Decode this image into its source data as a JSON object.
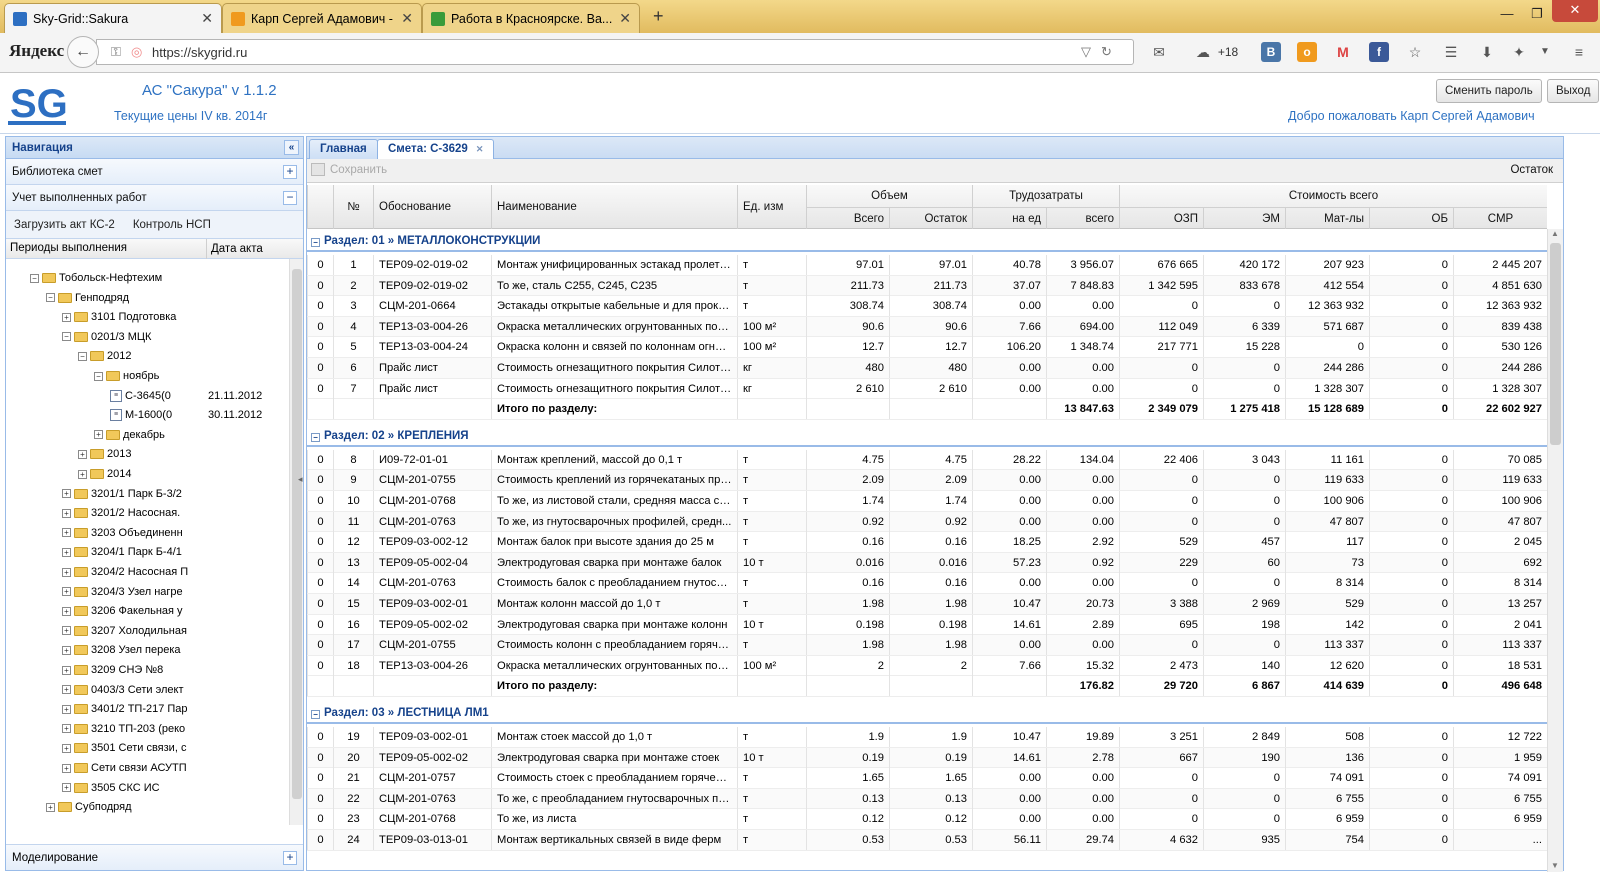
{
  "browser": {
    "tabs": [
      {
        "title": "Sky-Grid::Sakura",
        "color": "#2d6fc2"
      },
      {
        "title": "Карп Сергей Адамович - ...",
        "color": "#f09a1e"
      },
      {
        "title": "Работа в Красноярске. Ва...",
        "color": "#3a9b3a"
      }
    ],
    "new_tab": "+",
    "brand": "Яндекс",
    "url": "https://skygrid.ru",
    "weather": "+18",
    "win_min": "—",
    "win_max": "❐",
    "win_close": "✕"
  },
  "app": {
    "title": "АС \"Сакура\" v 1.1.2",
    "subtitle": "Текущие цены IV кв. 2014г",
    "change_password": "Сменить пароль",
    "logout": "Выход",
    "welcome": "Добро пожаловать Карп Сергей Адамович"
  },
  "nav": {
    "title": "Навигация",
    "library": "Библиотека смет",
    "works": "Учет выполненных работ",
    "load_act": "Загрузить акт КС-2",
    "control": "Контроль НСП",
    "col_periods": "Периоды выполнения",
    "col_date": "Дата акта",
    "modeling": "Моделирование",
    "tree": [
      {
        "label": "Тобольск-Нефтехим",
        "level": 2,
        "type": "folder",
        "expanded": true
      },
      {
        "label": "Генподряд",
        "level": 3,
        "type": "folder",
        "expanded": true
      },
      {
        "label": "3101 Подготовка",
        "level": 4,
        "type": "folder",
        "expanded": false
      },
      {
        "label": "0201/3 МЦК",
        "level": 4,
        "type": "folder",
        "expanded": true
      },
      {
        "label": "2012",
        "level": 5,
        "type": "folder",
        "expanded": true
      },
      {
        "label": "ноябрь",
        "level": 6,
        "type": "folder",
        "expanded": true
      },
      {
        "label": "С-3645(0",
        "level": 7,
        "type": "doc",
        "date": "21.11.2012"
      },
      {
        "label": "М-1600(0",
        "level": 7,
        "type": "doc",
        "date": "30.11.2012"
      },
      {
        "label": "декабрь",
        "level": 6,
        "type": "folder",
        "expanded": false
      },
      {
        "label": "2013",
        "level": 5,
        "type": "folder",
        "expanded": false
      },
      {
        "label": "2014",
        "level": 5,
        "type": "folder",
        "expanded": false
      },
      {
        "label": "3201/1 Парк Б-3/2",
        "level": 4,
        "type": "folder",
        "expanded": false
      },
      {
        "label": "3201/2 Насосная.",
        "level": 4,
        "type": "folder",
        "expanded": false
      },
      {
        "label": "3203 Объединенн",
        "level": 4,
        "type": "folder",
        "expanded": false
      },
      {
        "label": "3204/1 Парк Б-4/1",
        "level": 4,
        "type": "folder",
        "expanded": false
      },
      {
        "label": "3204/2 Насосная П",
        "level": 4,
        "type": "folder",
        "expanded": false
      },
      {
        "label": "3204/3 Узел нагре",
        "level": 4,
        "type": "folder",
        "expanded": false
      },
      {
        "label": "3206 Факельная у",
        "level": 4,
        "type": "folder",
        "expanded": false
      },
      {
        "label": "3207 Холодильная",
        "level": 4,
        "type": "folder",
        "expanded": false
      },
      {
        "label": "3208 Узел перека",
        "level": 4,
        "type": "folder",
        "expanded": false
      },
      {
        "label": "3209 СНЭ №8",
        "level": 4,
        "type": "folder",
        "expanded": false
      },
      {
        "label": "0403/3 Сети элект",
        "level": 4,
        "type": "folder",
        "expanded": false
      },
      {
        "label": "3401/2 ТП-217 Пар",
        "level": 4,
        "type": "folder",
        "expanded": false
      },
      {
        "label": "3210 ТП-203 (реко",
        "level": 4,
        "type": "folder",
        "expanded": false
      },
      {
        "label": "3501 Сети связи, с",
        "level": 4,
        "type": "folder",
        "expanded": false
      },
      {
        "label": "Сети связи АСУТП",
        "level": 4,
        "type": "folder",
        "expanded": false
      },
      {
        "label": "3505 СКС ИС",
        "level": 4,
        "type": "folder",
        "expanded": false
      },
      {
        "label": "Субподряд",
        "level": 3,
        "type": "folder",
        "expanded": false
      }
    ]
  },
  "main": {
    "tabs": [
      "Главная",
      "Смета: С-3629"
    ],
    "save": "Сохранить",
    "remainder": "Остаток",
    "headers": {
      "check": "",
      "num": "№",
      "basis": "Обоснование",
      "name": "Наименование",
      "unit": "Ед. изм",
      "volume": "Объем",
      "vol_total": "Всего",
      "vol_rest": "Остаток",
      "labor": "Трудозатраты",
      "labor_unit": "на ед",
      "labor_total": "всего",
      "cost": "Стоимость всего",
      "ozp": "ОЗП",
      "em": "ЭМ",
      "mat": "Мат-лы",
      "ob": "ОБ",
      "smr": "СМР"
    },
    "sections": [
      {
        "title": "Раздел: 01 » МЕТАЛЛОКОНСТРУКЦИИ",
        "rows": [
          [
            "0",
            "1",
            "ТЕР09-02-019-02",
            "Монтаж унифицированных эстакад пролето...",
            "т",
            "97.01",
            "97.01",
            "40.78",
            "3 956.07",
            "676 665",
            "420 172",
            "207 923",
            "0",
            "2 445 207"
          ],
          [
            "0",
            "2",
            "ТЕР09-02-019-02",
            "То же, сталь С255, С245, С235",
            "т",
            "211.73",
            "211.73",
            "37.07",
            "7 848.83",
            "1 342 595",
            "833 678",
            "412 554",
            "0",
            "4 851 630"
          ],
          [
            "0",
            "3",
            "СЦМ-201-0664",
            "Эстакады открытые кабельные и для прокл...",
            "т",
            "308.74",
            "308.74",
            "0.00",
            "0.00",
            "0",
            "0",
            "12 363 932",
            "0",
            "12 363 932"
          ],
          [
            "0",
            "4",
            "ТЕР13-03-004-26",
            "Окраска металлических огрунтованных пов...",
            "100 м²",
            "90.6",
            "90.6",
            "7.66",
            "694.00",
            "112 049",
            "6 339",
            "571 687",
            "0",
            "839 438"
          ],
          [
            "0",
            "5",
            "ТЕР13-03-004-24",
            "Окраска колонн и связей по колоннам огнез...",
            "100 м²",
            "12.7",
            "12.7",
            "106.20",
            "1 348.74",
            "217 771",
            "15 228",
            "0",
            "0",
            "530 126"
          ],
          [
            "0",
            "6",
            "Прайс лист",
            "Стоимость огнезащитного покрытия Силоте...",
            "кг",
            "480",
            "480",
            "0.00",
            "0.00",
            "0",
            "0",
            "244 286",
            "0",
            "244 286"
          ],
          [
            "0",
            "7",
            "Прайс лист",
            "Стоимость огнезащитного покрытия Силоте...",
            "кг",
            "2 610",
            "2 610",
            "0.00",
            "0.00",
            "0",
            "0",
            "1 328 307",
            "0",
            "1 328 307"
          ]
        ],
        "total": {
          "label": "Итого по разделу:",
          "labor": "13 847.63",
          "ozp": "2 349 079",
          "em": "1 275 418",
          "mat": "15 128 689",
          "ob": "0",
          "smr": "22 602 927"
        }
      },
      {
        "title": "Раздел: 02 » КРЕПЛЕНИЯ",
        "rows": [
          [
            "0",
            "8",
            "И09-72-01-01",
            "Монтаж креплений, массой до 0,1 т",
            "т",
            "4.75",
            "4.75",
            "28.22",
            "134.04",
            "22 406",
            "3 043",
            "11 161",
            "0",
            "70 085"
          ],
          [
            "0",
            "9",
            "СЦМ-201-0755",
            "Стоимость креплений из горячекатаных про...",
            "т",
            "2.09",
            "2.09",
            "0.00",
            "0.00",
            "0",
            "0",
            "119 633",
            "0",
            "119 633"
          ],
          [
            "0",
            "10",
            "СЦМ-201-0768",
            "То же, из листовой стали, средняя масса сбо...",
            "т",
            "1.74",
            "1.74",
            "0.00",
            "0.00",
            "0",
            "0",
            "100 906",
            "0",
            "100 906"
          ],
          [
            "0",
            "11",
            "СЦМ-201-0763",
            "То же, из гнутосварочных профилей, средн...",
            "т",
            "0.92",
            "0.92",
            "0.00",
            "0.00",
            "0",
            "0",
            "47 807",
            "0",
            "47 807"
          ],
          [
            "0",
            "12",
            "ТЕР09-03-002-12",
            "Монтаж балок при высоте здания до 25 м",
            "т",
            "0.16",
            "0.16",
            "18.25",
            "2.92",
            "529",
            "457",
            "117",
            "0",
            "2 045"
          ],
          [
            "0",
            "13",
            "ТЕР09-05-002-04",
            "Электродуговая сварка при монтаже балок",
            "10 т",
            "0.016",
            "0.016",
            "57.23",
            "0.92",
            "229",
            "60",
            "73",
            "0",
            "692"
          ],
          [
            "0",
            "14",
            "СЦМ-201-0763",
            "Стоимость балок с преобладанием гнутосва...",
            "т",
            "0.16",
            "0.16",
            "0.00",
            "0.00",
            "0",
            "0",
            "8 314",
            "0",
            "8 314"
          ],
          [
            "0",
            "15",
            "ТЕР09-03-002-01",
            "Монтаж колонн массой до 1,0 т",
            "т",
            "1.98",
            "1.98",
            "10.47",
            "20.73",
            "3 388",
            "2 969",
            "529",
            "0",
            "13 257"
          ],
          [
            "0",
            "16",
            "ТЕР09-05-002-02",
            "Электродуговая сварка при монтаже колонн",
            "10 т",
            "0.198",
            "0.198",
            "14.61",
            "2.89",
            "695",
            "198",
            "142",
            "0",
            "2 041"
          ],
          [
            "0",
            "17",
            "СЦМ-201-0755",
            "Стоимость колонн с преобладанием горячек...",
            "т",
            "1.98",
            "1.98",
            "0.00",
            "0.00",
            "0",
            "0",
            "113 337",
            "0",
            "113 337"
          ],
          [
            "0",
            "18",
            "ТЕР13-03-004-26",
            "Окраска металлических огрунтованных пов...",
            "100 м²",
            "2",
            "2",
            "7.66",
            "15.32",
            "2 473",
            "140",
            "12 620",
            "0",
            "18 531"
          ]
        ],
        "total": {
          "label": "Итого по разделу:",
          "labor": "176.82",
          "ozp": "29 720",
          "em": "6 867",
          "mat": "414 639",
          "ob": "0",
          "smr": "496 648"
        }
      },
      {
        "title": "Раздел: 03 » ЛЕСТНИЦА ЛМ1",
        "rows": [
          [
            "0",
            "19",
            "ТЕР09-03-002-01",
            "Монтаж стоек массой до 1,0 т",
            "т",
            "1.9",
            "1.9",
            "10.47",
            "19.89",
            "3 251",
            "2 849",
            "508",
            "0",
            "12 722"
          ],
          [
            "0",
            "20",
            "ТЕР09-05-002-02",
            "Электродуговая сварка при монтаже стоек",
            "10 т",
            "0.19",
            "0.19",
            "14.61",
            "2.78",
            "667",
            "190",
            "136",
            "0",
            "1 959"
          ],
          [
            "0",
            "21",
            "СЦМ-201-0757",
            "Стоимость стоек с преобладанием горячека...",
            "т",
            "1.65",
            "1.65",
            "0.00",
            "0.00",
            "0",
            "0",
            "74 091",
            "0",
            "74 091"
          ],
          [
            "0",
            "22",
            "СЦМ-201-0763",
            "То же, с преобладанием гнутосварочных пр...",
            "т",
            "0.13",
            "0.13",
            "0.00",
            "0.00",
            "0",
            "0",
            "6 755",
            "0",
            "6 755"
          ],
          [
            "0",
            "23",
            "СЦМ-201-0768",
            "То же, из листа",
            "т",
            "0.12",
            "0.12",
            "0.00",
            "0.00",
            "0",
            "0",
            "6 959",
            "0",
            "6 959"
          ],
          [
            "0",
            "24",
            "ТЕР09-03-013-01",
            "Монтаж вертикальных связей в виде ферм",
            "т",
            "0.53",
            "0.53",
            "56.11",
            "29.74",
            "4 632",
            "935",
            "754",
            "0",
            "..."
          ]
        ]
      }
    ]
  }
}
